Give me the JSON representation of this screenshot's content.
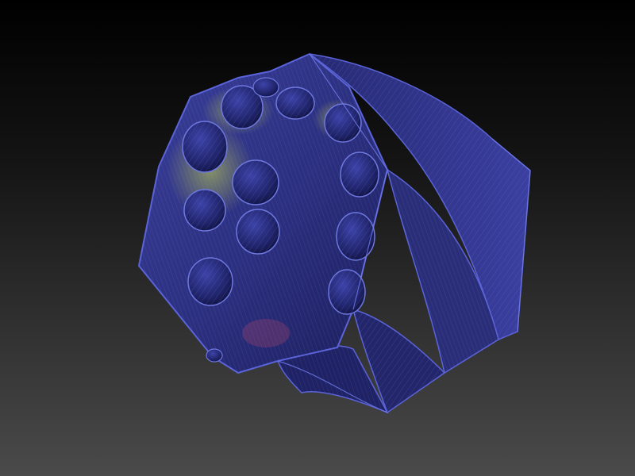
{
  "viewport": {
    "background_top": "#000000",
    "background_bottom": "#4a4a4a"
  },
  "model": {
    "icon": "twisted-hex-mesh-icon",
    "base_color": "#2b2f7e",
    "dark_color": "#161a52",
    "edge_color": "#5a63d8",
    "wire_color": "#7b86e8",
    "highlight_color": "#c8d84a",
    "accent_color": "#d04a6a",
    "hole_count": 13
  }
}
